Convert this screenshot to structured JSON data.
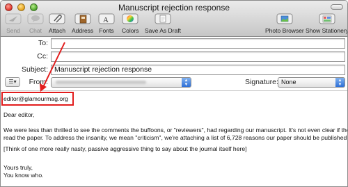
{
  "window": {
    "title": "Manuscript rejection response"
  },
  "toolbar": {
    "send": "Send",
    "chat": "Chat",
    "attach": "Attach",
    "address": "Address",
    "fonts": "Fonts",
    "colors": "Colors",
    "save_as_draft": "Save As Draft",
    "photo_browser": "Photo Browser",
    "show_stationery": "Show Stationery"
  },
  "header": {
    "to_label": "To:",
    "to_value": "",
    "cc_label": "Cc:",
    "cc_value": "",
    "subject_label": "Subject:",
    "subject_value": "Manuscript rejection response",
    "from_label": "From:",
    "signature_label": "Signature:",
    "signature_value": "None"
  },
  "annotation": {
    "highlight_color": "#e21c1c"
  },
  "message": {
    "address_line": "editor@glamourmag.org",
    "greeting": "Dear editor,",
    "para1_line1": "We were less than thrilled to see the comments the buffoons, or \"reviewers\", had regarding our manuscript.  It's not even clear if they",
    "para1_line2": "read the paper.  To address the insanity, we mean \"criticism\", we're attaching a list of 6,728 reasons our paper should be published.",
    "para2": "[Think of one more really nasty, passive aggressive thing to say about the journal itself here]",
    "closing": "Yours truly,",
    "signoff": "You know who."
  }
}
